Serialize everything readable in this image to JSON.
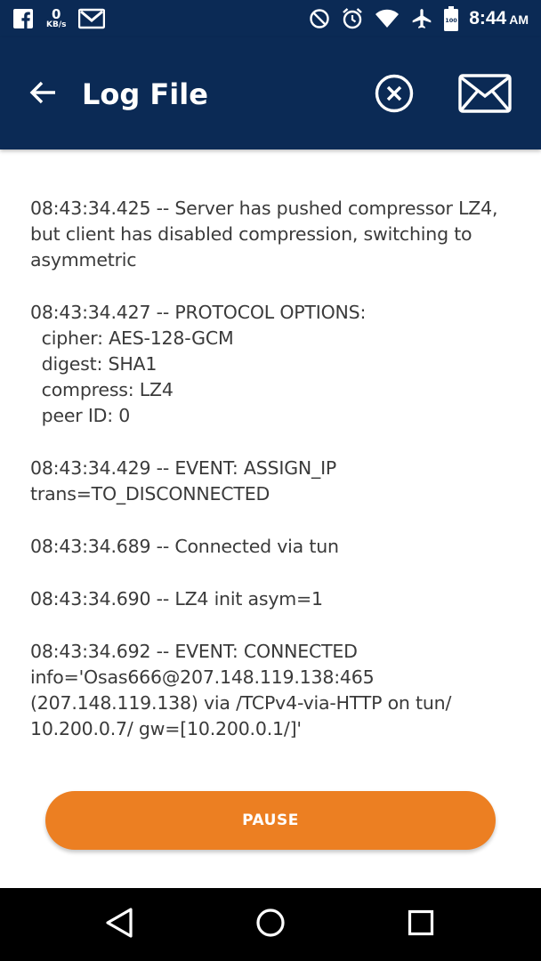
{
  "status_bar": {
    "data_rate_value": "0",
    "data_rate_unit": "KB/s",
    "battery_level": "100",
    "time": "8:44",
    "ampm": "AM",
    "icons": [
      "facebook-icon",
      "data-rate-indicator",
      "gmail-icon",
      "do-not-disturb-icon",
      "alarm-icon",
      "wifi-icon",
      "airplane-mode-icon",
      "battery-icon"
    ]
  },
  "app_bar": {
    "title": "Log File",
    "icons": [
      "back-arrow-icon",
      "close-circle-icon",
      "mail-icon"
    ],
    "background_color": "#0b2a55"
  },
  "log": {
    "entries": [
      "08:43:34.425 -- Server has pushed compressor LZ4, but client has disabled compression, switching to asymmetric",
      "08:43:34.427 -- PROTOCOL OPTIONS:\n  cipher: AES-128-GCM\n  digest: SHA1\n  compress: LZ4\n  peer ID: 0",
      "08:43:34.429 -- EVENT: ASSIGN_IP trans=TO_DISCONNECTED",
      "08:43:34.689 -- Connected via tun",
      "08:43:34.690 -- LZ4 init asym=1",
      "08:43:34.692 -- EVENT: CONNECTED info='Osas666@207.148.119.138:465 (207.148.119.138) via /TCPv4-via-HTTP on tun/ 10.200.0.7/ gw=[10.200.0.1/]'"
    ]
  },
  "pause_button": {
    "label": "PAUSE",
    "color": "#ec7f22"
  },
  "nav_bar": {
    "icons": [
      "back-triangle-icon",
      "home-circle-icon",
      "recents-square-icon"
    ]
  }
}
